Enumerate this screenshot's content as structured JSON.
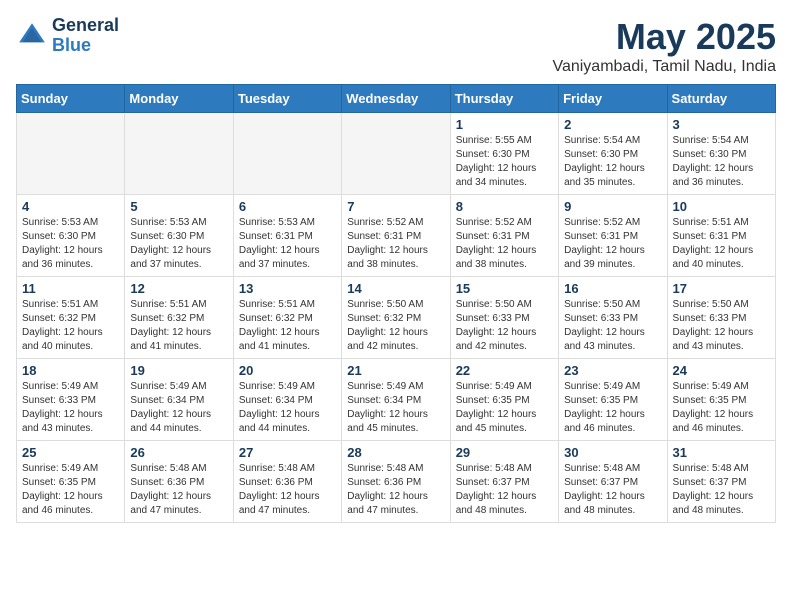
{
  "header": {
    "logo_line1": "General",
    "logo_line2": "Blue",
    "month_title": "May 2025",
    "location": "Vaniyambadi, Tamil Nadu, India"
  },
  "weekdays": [
    "Sunday",
    "Monday",
    "Tuesday",
    "Wednesday",
    "Thursday",
    "Friday",
    "Saturday"
  ],
  "weeks": [
    [
      {
        "day": "",
        "info": ""
      },
      {
        "day": "",
        "info": ""
      },
      {
        "day": "",
        "info": ""
      },
      {
        "day": "",
        "info": ""
      },
      {
        "day": "1",
        "info": "Sunrise: 5:55 AM\nSunset: 6:30 PM\nDaylight: 12 hours\nand 34 minutes."
      },
      {
        "day": "2",
        "info": "Sunrise: 5:54 AM\nSunset: 6:30 PM\nDaylight: 12 hours\nand 35 minutes."
      },
      {
        "day": "3",
        "info": "Sunrise: 5:54 AM\nSunset: 6:30 PM\nDaylight: 12 hours\nand 36 minutes."
      }
    ],
    [
      {
        "day": "4",
        "info": "Sunrise: 5:53 AM\nSunset: 6:30 PM\nDaylight: 12 hours\nand 36 minutes."
      },
      {
        "day": "5",
        "info": "Sunrise: 5:53 AM\nSunset: 6:30 PM\nDaylight: 12 hours\nand 37 minutes."
      },
      {
        "day": "6",
        "info": "Sunrise: 5:53 AM\nSunset: 6:31 PM\nDaylight: 12 hours\nand 37 minutes."
      },
      {
        "day": "7",
        "info": "Sunrise: 5:52 AM\nSunset: 6:31 PM\nDaylight: 12 hours\nand 38 minutes."
      },
      {
        "day": "8",
        "info": "Sunrise: 5:52 AM\nSunset: 6:31 PM\nDaylight: 12 hours\nand 38 minutes."
      },
      {
        "day": "9",
        "info": "Sunrise: 5:52 AM\nSunset: 6:31 PM\nDaylight: 12 hours\nand 39 minutes."
      },
      {
        "day": "10",
        "info": "Sunrise: 5:51 AM\nSunset: 6:31 PM\nDaylight: 12 hours\nand 40 minutes."
      }
    ],
    [
      {
        "day": "11",
        "info": "Sunrise: 5:51 AM\nSunset: 6:32 PM\nDaylight: 12 hours\nand 40 minutes."
      },
      {
        "day": "12",
        "info": "Sunrise: 5:51 AM\nSunset: 6:32 PM\nDaylight: 12 hours\nand 41 minutes."
      },
      {
        "day": "13",
        "info": "Sunrise: 5:51 AM\nSunset: 6:32 PM\nDaylight: 12 hours\nand 41 minutes."
      },
      {
        "day": "14",
        "info": "Sunrise: 5:50 AM\nSunset: 6:32 PM\nDaylight: 12 hours\nand 42 minutes."
      },
      {
        "day": "15",
        "info": "Sunrise: 5:50 AM\nSunset: 6:33 PM\nDaylight: 12 hours\nand 42 minutes."
      },
      {
        "day": "16",
        "info": "Sunrise: 5:50 AM\nSunset: 6:33 PM\nDaylight: 12 hours\nand 43 minutes."
      },
      {
        "day": "17",
        "info": "Sunrise: 5:50 AM\nSunset: 6:33 PM\nDaylight: 12 hours\nand 43 minutes."
      }
    ],
    [
      {
        "day": "18",
        "info": "Sunrise: 5:49 AM\nSunset: 6:33 PM\nDaylight: 12 hours\nand 43 minutes."
      },
      {
        "day": "19",
        "info": "Sunrise: 5:49 AM\nSunset: 6:34 PM\nDaylight: 12 hours\nand 44 minutes."
      },
      {
        "day": "20",
        "info": "Sunrise: 5:49 AM\nSunset: 6:34 PM\nDaylight: 12 hours\nand 44 minutes."
      },
      {
        "day": "21",
        "info": "Sunrise: 5:49 AM\nSunset: 6:34 PM\nDaylight: 12 hours\nand 45 minutes."
      },
      {
        "day": "22",
        "info": "Sunrise: 5:49 AM\nSunset: 6:35 PM\nDaylight: 12 hours\nand 45 minutes."
      },
      {
        "day": "23",
        "info": "Sunrise: 5:49 AM\nSunset: 6:35 PM\nDaylight: 12 hours\nand 46 minutes."
      },
      {
        "day": "24",
        "info": "Sunrise: 5:49 AM\nSunset: 6:35 PM\nDaylight: 12 hours\nand 46 minutes."
      }
    ],
    [
      {
        "day": "25",
        "info": "Sunrise: 5:49 AM\nSunset: 6:35 PM\nDaylight: 12 hours\nand 46 minutes."
      },
      {
        "day": "26",
        "info": "Sunrise: 5:48 AM\nSunset: 6:36 PM\nDaylight: 12 hours\nand 47 minutes."
      },
      {
        "day": "27",
        "info": "Sunrise: 5:48 AM\nSunset: 6:36 PM\nDaylight: 12 hours\nand 47 minutes."
      },
      {
        "day": "28",
        "info": "Sunrise: 5:48 AM\nSunset: 6:36 PM\nDaylight: 12 hours\nand 47 minutes."
      },
      {
        "day": "29",
        "info": "Sunrise: 5:48 AM\nSunset: 6:37 PM\nDaylight: 12 hours\nand 48 minutes."
      },
      {
        "day": "30",
        "info": "Sunrise: 5:48 AM\nSunset: 6:37 PM\nDaylight: 12 hours\nand 48 minutes."
      },
      {
        "day": "31",
        "info": "Sunrise: 5:48 AM\nSunset: 6:37 PM\nDaylight: 12 hours\nand 48 minutes."
      }
    ]
  ]
}
